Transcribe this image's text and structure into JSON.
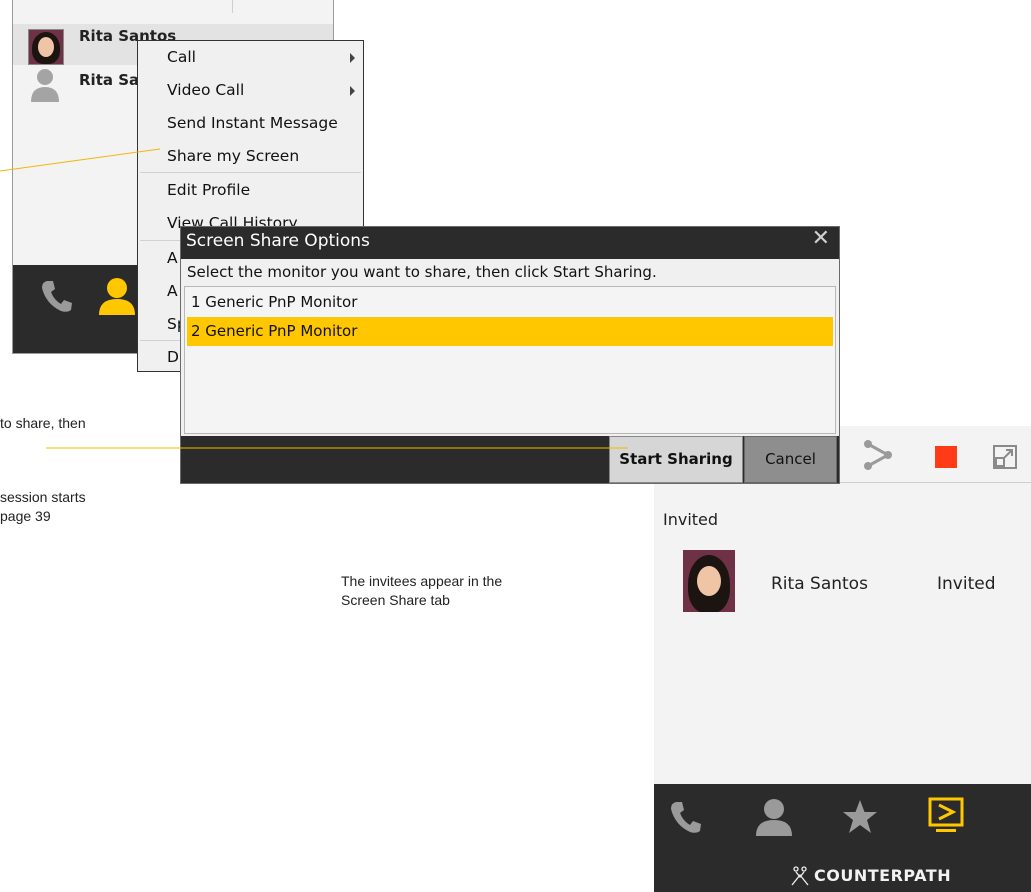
{
  "contacts": {
    "items": [
      {
        "name": "Rita Santos"
      },
      {
        "name": "Rita Sa"
      }
    ]
  },
  "context_menu": {
    "items": [
      {
        "label": "Call",
        "submenu": true
      },
      {
        "label": "Video Call",
        "submenu": true
      },
      {
        "label": "Send Instant Message"
      },
      {
        "label": "Share my Screen"
      },
      {
        "label": "Edit Profile"
      },
      {
        "label": "View Call History"
      },
      {
        "label": "A"
      },
      {
        "label": "A"
      },
      {
        "label": "Sp"
      },
      {
        "label": "D"
      }
    ]
  },
  "dialog": {
    "title": "Screen Share Options",
    "close_glyph": "✕",
    "instruction": "Select the monitor you want to share, then click Start Sharing.",
    "monitors": [
      {
        "label": "1 Generic PnP Monitor",
        "selected": false
      },
      {
        "label": "2 Generic PnP Monitor",
        "selected": true
      }
    ],
    "start_label": "Start Sharing",
    "cancel_label": "Cancel",
    "selection_color": "#ffc700"
  },
  "share_panel": {
    "toolbar_icons": [
      "share-icon",
      "stop-icon",
      "popout-icon"
    ],
    "section_header": "Invited",
    "invitees": [
      {
        "name": "Rita Santos",
        "status": "Invited"
      }
    ],
    "footer_icons": [
      "phone-icon",
      "contacts-icon",
      "favorites-icon",
      "screen-share-icon"
    ],
    "active_footer_icon": "screen-share-icon",
    "brand": "COUNTERPATH",
    "accent_color": "#ffc700",
    "stop_color": "#ff3a17"
  },
  "callouts": {
    "share_text_line1": "to share, then",
    "session_line1": "session starts",
    "session_line2": "page 39",
    "invitees_line1": "The invitees appear in the",
    "invitees_line2": "Screen Share tab"
  }
}
